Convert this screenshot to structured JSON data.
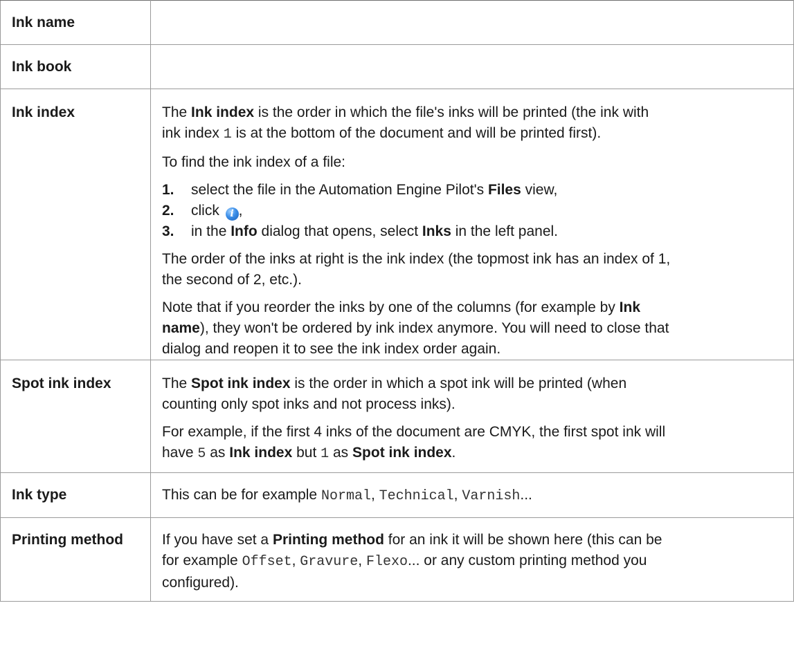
{
  "rows": {
    "ink_name": {
      "term": "Ink name"
    },
    "ink_book": {
      "term": "Ink book"
    },
    "ink_index": {
      "term": "Ink index",
      "p1": {
        "t1": "The ",
        "b1": "Ink index",
        "t2": " is the order in which the file's inks will be printed (the ink with",
        "t3": "ink index ",
        "c1": "1",
        "t4": " is at the bottom of the document and will be printed first)."
      },
      "p2": "To find the ink index of a file:",
      "steps": {
        "s1": {
          "num": "1.",
          "t1": "select the file in the Automation Engine Pilot's ",
          "b1": "Files",
          "t2": " view,"
        },
        "s2": {
          "num": "2.",
          "t1": "click ",
          "icon": "i",
          "t2": ","
        },
        "s3": {
          "num": "3.",
          "t1": "in the ",
          "b1": "Info",
          "t2": " dialog that opens, select ",
          "b2": "Inks",
          "t3": " in the left panel."
        }
      },
      "p3": {
        "l1": "The order of the inks at right is the ink index (the topmost ink has an index of 1,",
        "l2": "the second of 2, etc.)."
      },
      "p4": {
        "t1": "Note that if you reorder the inks by one of the columns (for example by ",
        "b1": "Ink",
        "b2": "name",
        "t2": "), they won't be ordered by ink index anymore. You will need to close that",
        "l3": "dialog and reopen it to see the ink index order again."
      }
    },
    "spot_ink_index": {
      "term": "Spot ink index",
      "p1": {
        "t1": "The ",
        "b1": "Spot ink index",
        "t2": " is the order in which a spot ink will be printed (when",
        "l2": "counting only spot inks and not process inks)."
      },
      "p2": {
        "l1": "For example, if the first 4 inks of the document are CMYK, the first spot ink will",
        "t1": "have ",
        "c1": "5",
        "t2": " as ",
        "b1": "Ink index",
        "t3": " but ",
        "c2": "1",
        "t4": " as ",
        "b2": "Spot ink index",
        "t5": "."
      }
    },
    "ink_type": {
      "term": "Ink type",
      "t1": "This can be for example ",
      "c1": "Normal",
      "t2": ", ",
      "c2": "Technical",
      "t3": ", ",
      "c3": "Varnish",
      "t4": "..."
    },
    "printing_method": {
      "term": "Printing method",
      "t1": "If you have set a ",
      "b1": "Printing method",
      "t2": " for an ink it will be shown here (this can be",
      "t3": "for example ",
      "c1": "Offset",
      "t4": ", ",
      "c2": "Gravure",
      "t5": ", ",
      "c3": "Flexo",
      "t6": "... or any custom printing method you",
      "l3": "configured)."
    }
  }
}
